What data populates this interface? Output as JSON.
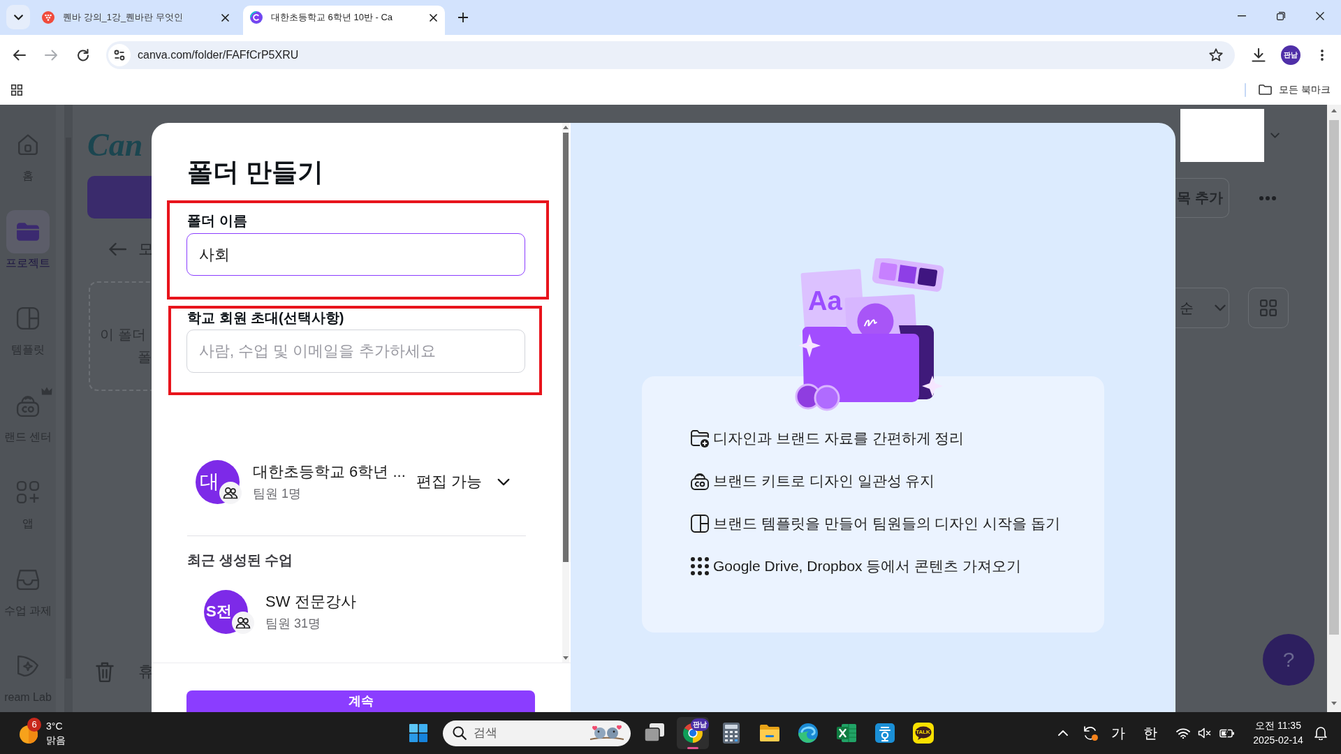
{
  "browser": {
    "tabs": [
      {
        "title": "퀜바 강의_1강_퀜바란 무엇인",
        "kind": "video",
        "selected": false
      },
      {
        "title": "대한초등학교 6학년 10반 - Ca",
        "kind": "canva",
        "selected": true
      }
    ],
    "nav": [
      {
        "kind": "back",
        "disabled": false
      },
      {
        "kind": "forward",
        "disabled": true
      },
      {
        "kind": "reload",
        "disabled": false
      }
    ],
    "url": "canva.com/folder/FAFfCrP5XRU",
    "profile": "판남",
    "bookmarks_folder": "모든 북마크"
  },
  "sidebar": {
    "items": [
      {
        "kind": "home",
        "label": "홈",
        "selected": false,
        "premium": false
      },
      {
        "kind": "projects",
        "label": "프로젝트",
        "selected": true,
        "premium": false
      },
      {
        "kind": "templates",
        "label": "템플릿",
        "selected": false,
        "premium": false
      },
      {
        "kind": "brand",
        "label": "랜드 센터",
        "selected": false,
        "premium": true
      },
      {
        "kind": "apps",
        "label": "앱",
        "selected": false,
        "premium": false
      },
      {
        "kind": "assignments",
        "label": "수업 과제",
        "selected": false,
        "premium": false
      },
      {
        "kind": "dreamlab",
        "label": "ream Lab",
        "selected": false,
        "premium": false
      }
    ]
  },
  "page": {
    "logo": "Can",
    "back_label": "모",
    "empty_state": [
      "이 폴더",
      "폴"
    ],
    "trash_label": "휴",
    "add_button": "목 추가",
    "sort_label": "순",
    "help": "?"
  },
  "dialog": {
    "title": "폴더 만들기",
    "fields": [
      {
        "label": "폴더 이름",
        "value": "사회",
        "focused": true,
        "highlighted": true
      },
      {
        "label": "학교 회원 초대(선택사항)",
        "placeholder": "사람, 수업 및 이메일을 추가하세요",
        "focused": false,
        "highlighted": true
      }
    ],
    "owner": {
      "avatar": "대",
      "name": "대한초등학교 6학년 ...",
      "members": "팀원 1명",
      "permission": "편집 가능"
    },
    "recent_heading": "최근 생성된 수업",
    "recent_classes": [
      {
        "avatar": "S전",
        "name": "SW 전문강사",
        "members": "팀원 31명"
      }
    ],
    "submit": "계속",
    "info": {
      "illustration_text": "Aa",
      "features": [
        {
          "kind": "folder",
          "text": "디자인과 브랜드 자료를 간편하게 정리"
        },
        {
          "kind": "brand-kit",
          "text": "브랜드 키트로 디자인 일관성 유지"
        },
        {
          "kind": "template",
          "text": "브랜드 템플릿을 만들어 팀원들의 디자인 시작을 돕기"
        },
        {
          "kind": "apps",
          "text": "Google Drive, Dropbox 등에서 콘텐츠 가져오기"
        }
      ]
    }
  },
  "taskbar": {
    "weather": {
      "badge": "6",
      "temperature": "3°C",
      "condition": "맑음"
    },
    "search_placeholder": "검색",
    "apps": [
      {
        "kind": "task-view",
        "selected": false
      },
      {
        "kind": "chrome",
        "selected": true,
        "badge": "판남"
      },
      {
        "kind": "calculator",
        "selected": false
      },
      {
        "kind": "explorer",
        "selected": false
      },
      {
        "kind": "edge",
        "selected": false
      },
      {
        "kind": "excel",
        "selected": false
      },
      {
        "kind": "hancom",
        "selected": false
      },
      {
        "kind": "kakaotalk",
        "selected": false,
        "label": "TALK"
      }
    ],
    "ime_mode": "가",
    "ime_language": "한",
    "volume_muted": true,
    "time": "오전 11:35",
    "date": "2025-02-14"
  }
}
